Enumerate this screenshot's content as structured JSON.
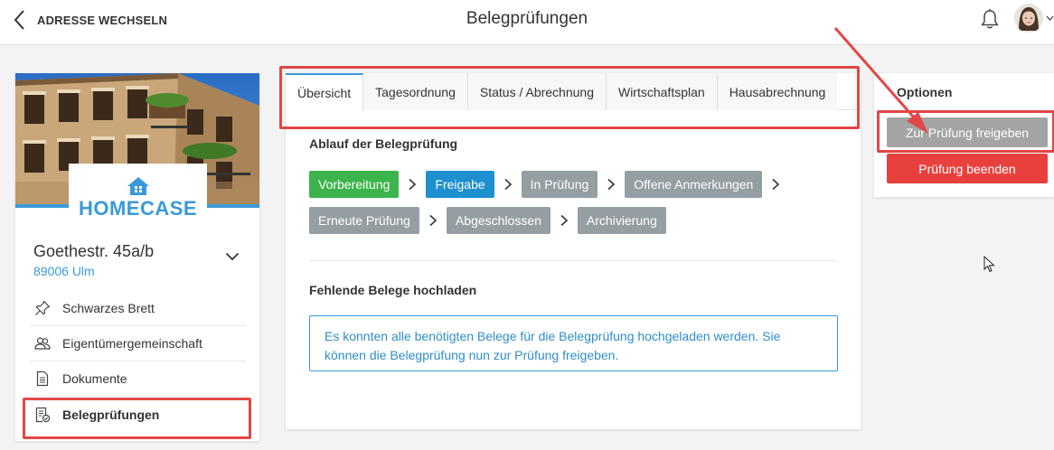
{
  "header": {
    "back_label": "ADRESSE WECHSELN",
    "title": "Belegprüfungen"
  },
  "property": {
    "logo_home": "HOME",
    "logo_case": "CASE",
    "street": "Goethestr. 45a/b",
    "city": "89006 Ulm"
  },
  "sidebar": {
    "items": [
      {
        "label": "Schwarzes Brett",
        "icon": "pin-icon"
      },
      {
        "label": "Eigentümergemeinschaft",
        "icon": "people-icon"
      },
      {
        "label": "Dokumente",
        "icon": "document-icon"
      },
      {
        "label": "Belegprüfungen",
        "icon": "receipt-check-icon",
        "active": true
      }
    ]
  },
  "tabs": [
    {
      "label": "Übersicht",
      "active": true
    },
    {
      "label": "Tagesordnung"
    },
    {
      "label": "Status / Abrechnung"
    },
    {
      "label": "Wirtschaftsplan"
    },
    {
      "label": "Hausabrechnung"
    }
  ],
  "main": {
    "flow_title": "Ablauf der Belegprüfung",
    "steps_row1": [
      "Vorbereitung",
      "Freigabe",
      "In Prüfung",
      "Offene Anmerkungen"
    ],
    "steps_row2": [
      "Erneute Prüfung",
      "Abgeschlossen",
      "Archivierung"
    ],
    "upload_title": "Fehlende Belege hochladen",
    "info_text": "Es konnten alle benötigten Belege für die Belegprüfung hochgeladen werden. Sie können die Belegprüfung nun zur Prüfung freigeben."
  },
  "options": {
    "title": "Optionen",
    "release_label": "Zur Prüfung freigeben",
    "finish_label": "Prüfung beenden"
  },
  "colors": {
    "accent": "#3a9ad9",
    "step_done": "#3cb44b",
    "step_current": "#1e8fcf",
    "step_pending": "#959ea3",
    "danger": "#e8413d",
    "annotation": "#e34646"
  }
}
